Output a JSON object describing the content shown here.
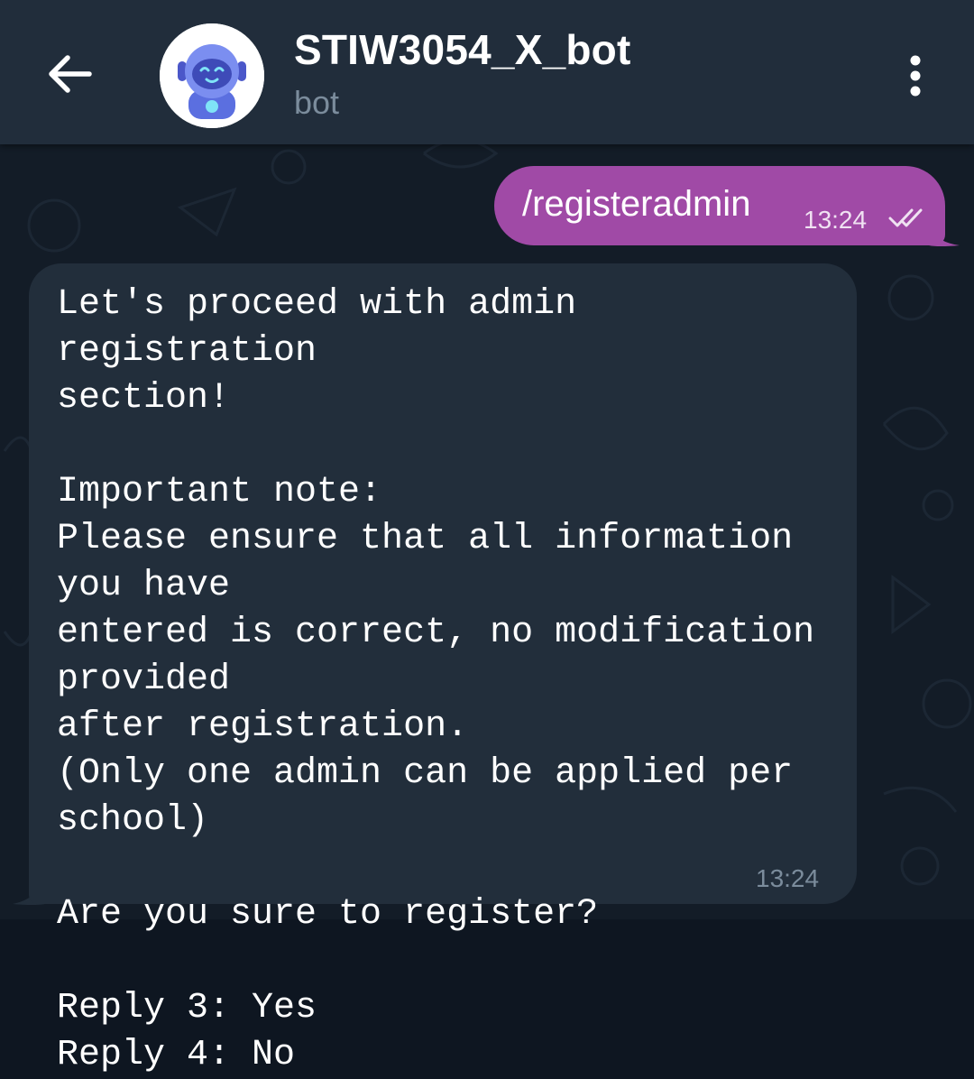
{
  "header": {
    "title": "STIW3054_X_bot",
    "subtitle": "bot",
    "back_icon": "arrow-left-icon",
    "menu_icon": "more-vertical-icon",
    "avatar_icon": "robot-avatar-icon"
  },
  "messages": {
    "outgoing": {
      "text": "/registeradmin",
      "time": "13:24",
      "status_icon": "double-check-icon",
      "color": "#a04aa6"
    },
    "incoming": {
      "text": "Let's proceed with admin registration\nsection!\n\nImportant note:\nPlease ensure that all information you have\nentered is correct, no modification provided\nafter registration.\n(Only one admin can be applied per school)\n\nAre you sure to register?\n\nReply 3: Yes\nReply 4: No",
      "time": "13:24",
      "color": "#222e3b"
    }
  },
  "colors": {
    "header_bg": "#212d3b",
    "chat_bg": "#131c27",
    "secondary_text": "#7b8c9c"
  }
}
